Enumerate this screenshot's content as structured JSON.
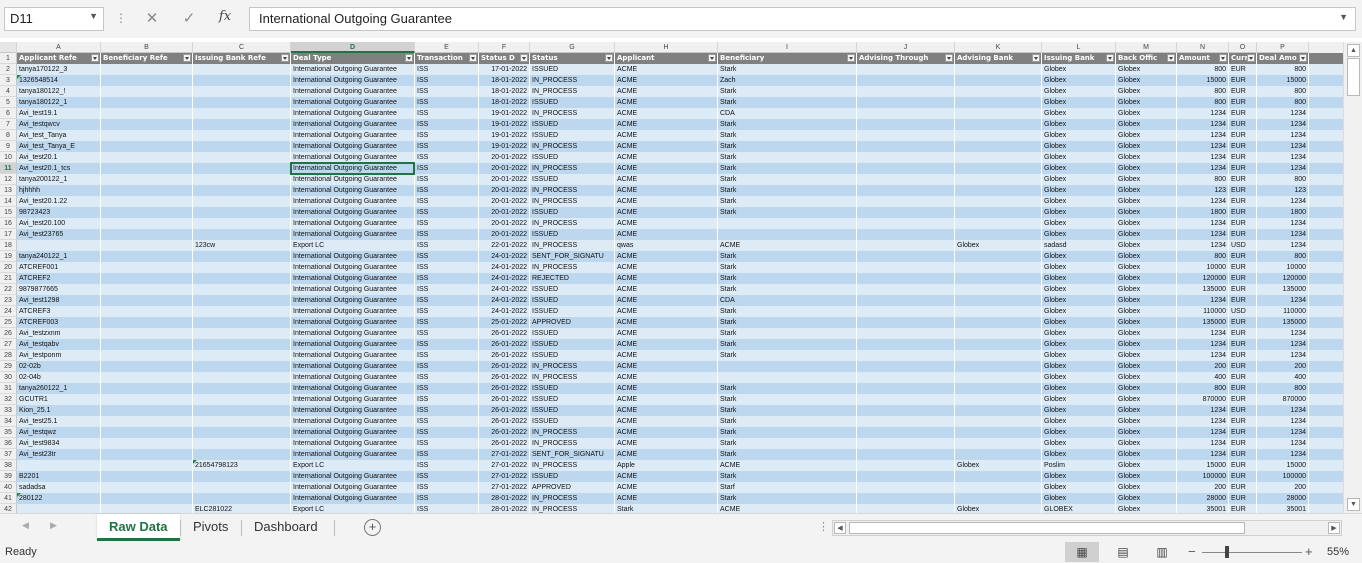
{
  "formula_bar": {
    "name_box": "D11",
    "cancel_icon": "✕",
    "enter_icon": "✓",
    "fx_label": "fx",
    "formula": "International Outgoing Guarantee"
  },
  "grid": {
    "column_letters": [
      "A",
      "B",
      "C",
      "D",
      "E",
      "F",
      "G",
      "H",
      "I",
      "J",
      "K",
      "L",
      "M",
      "N",
      "O",
      "P"
    ],
    "header_labels": [
      "Applicant Refe",
      "Beneficiary Refe",
      "Issuing Bank Refe",
      "Deal Type",
      "Transaction",
      "Status D",
      "Status",
      "Applicant",
      "Beneficiary",
      "Advising Through",
      "Advising Bank",
      "Issuing Bank",
      "Back Offic",
      "Amount",
      "Curre",
      "Deal Amo"
    ],
    "rows": [
      [
        "tanya170122_3",
        "",
        "",
        "International Outgoing Guarantee",
        "ISS",
        "17-01-2022",
        "ISSUED",
        "ACME",
        "Stark",
        "",
        "",
        "Globex",
        "Globex",
        "800",
        "EUR",
        "800"
      ],
      [
        "1326548514",
        "",
        "",
        "International Outgoing Guarantee",
        "ISS",
        "18-01-2022",
        "IN_PROCESS",
        "ACME",
        "Zach",
        "",
        "",
        "Globex",
        "Globex",
        "15000",
        "EUR",
        "15000"
      ],
      [
        "tanya180122_!",
        "",
        "",
        "International Outgoing Guarantee",
        "ISS",
        "18-01-2022",
        "IN_PROCESS",
        "ACME",
        "Stark",
        "",
        "",
        "Globex",
        "Globex",
        "800",
        "EUR",
        "800"
      ],
      [
        "tanya180122_1",
        "",
        "",
        "International Outgoing Guarantee",
        "ISS",
        "18-01-2022",
        "ISSUED",
        "ACME",
        "Stark",
        "",
        "",
        "Globex",
        "Globex",
        "800",
        "EUR",
        "800"
      ],
      [
        "Avi_test19.1",
        "",
        "",
        "International Outgoing Guarantee",
        "ISS",
        "19-01-2022",
        "IN_PROCESS",
        "ACME",
        "CDA",
        "",
        "",
        "Globex",
        "Globex",
        "1234",
        "EUR",
        "1234"
      ],
      [
        "Avi_testqwcv",
        "",
        "",
        "International Outgoing Guarantee",
        "ISS",
        "19-01-2022",
        "ISSUED",
        "ACME",
        "Stark",
        "",
        "",
        "Globex",
        "Globex",
        "1234",
        "EUR",
        "1234"
      ],
      [
        "Avi_test_Tanya",
        "",
        "",
        "International Outgoing Guarantee",
        "ISS",
        "19-01-2022",
        "ISSUED",
        "ACME",
        "Stark",
        "",
        "",
        "Globex",
        "Globex",
        "1234",
        "EUR",
        "1234"
      ],
      [
        "Avi_test_Tanya_E",
        "",
        "",
        "International Outgoing Guarantee",
        "ISS",
        "19-01-2022",
        "IN_PROCESS",
        "ACME",
        "Stark",
        "",
        "",
        "Globex",
        "Globex",
        "1234",
        "EUR",
        "1234"
      ],
      [
        "Avi_test20.1",
        "",
        "",
        "International Outgoing Guarantee",
        "ISS",
        "20-01-2022",
        "ISSUED",
        "ACME",
        "Stark",
        "",
        "",
        "Globex",
        "Globex",
        "1234",
        "EUR",
        "1234"
      ],
      [
        "Avi_test20.1_tcs",
        "",
        "",
        "International Outgoing Guarantee",
        "ISS",
        "20-01-2022",
        "IN_PROCESS",
        "ACME",
        "Stark",
        "",
        "",
        "Globex",
        "Globex",
        "1234",
        "EUR",
        "1234"
      ],
      [
        "tanya200122_1",
        "",
        "",
        "International Outgoing Guarantee",
        "ISS",
        "20-01-2022",
        "ISSUED",
        "ACME",
        "Stark",
        "",
        "",
        "Globex",
        "Globex",
        "800",
        "EUR",
        "800"
      ],
      [
        "hjhhhh",
        "",
        "",
        "International Outgoing Guarantee",
        "ISS",
        "20-01-2022",
        "IN_PROCESS",
        "ACME",
        "Stark",
        "",
        "",
        "Globex",
        "Globex",
        "123",
        "EUR",
        "123"
      ],
      [
        "Avi_test20.1.22",
        "",
        "",
        "International Outgoing Guarantee",
        "ISS",
        "20-01-2022",
        "IN_PROCESS",
        "ACME",
        "Stark",
        "",
        "",
        "Globex",
        "Globex",
        "1234",
        "EUR",
        "1234"
      ],
      [
        "98723423",
        "",
        "",
        "International Outgoing Guarantee",
        "ISS",
        "20-01-2022",
        "ISSUED",
        "ACME",
        "Stark",
        "",
        "",
        "Globex",
        "Globex",
        "1800",
        "EUR",
        "1800"
      ],
      [
        "Avi_test20.100",
        "",
        "",
        "International Outgoing Guarantee",
        "ISS",
        "20-01-2022",
        "IN_PROCESS",
        "ACME",
        "",
        "",
        "",
        "Globex",
        "Globex",
        "1234",
        "EUR",
        "1234"
      ],
      [
        "Avi_test23765",
        "",
        "",
        "International Outgoing Guarantee",
        "ISS",
        "20-01-2022",
        "ISSUED",
        "ACME",
        "",
        "",
        "",
        "Globex",
        "Globex",
        "1234",
        "EUR",
        "1234"
      ],
      [
        "",
        "",
        "123cw",
        "Export LC",
        "ISS",
        "22-01-2022",
        "IN_PROCESS",
        "qwas",
        "ACME",
        "",
        "Globex",
        "sadasd",
        "Globex",
        "1234",
        "USD",
        "1234"
      ],
      [
        "tanya240122_1",
        "",
        "",
        "International Outgoing Guarantee",
        "ISS",
        "24-01-2022",
        "SENT_FOR_SIGNATU",
        "ACME",
        "Stark",
        "",
        "",
        "Globex",
        "Globex",
        "800",
        "EUR",
        "800"
      ],
      [
        "ATCREF001",
        "",
        "",
        "International Outgoing Guarantee",
        "ISS",
        "24-01-2022",
        "IN_PROCESS",
        "ACME",
        "Stark",
        "",
        "",
        "Globex",
        "Globex",
        "10000",
        "EUR",
        "10000"
      ],
      [
        "ATCREF2",
        "",
        "",
        "International Outgoing Guarantee",
        "ISS",
        "24-01-2022",
        "REJECTED",
        "ACME",
        "Stark",
        "",
        "",
        "Globex",
        "Globex",
        "120000",
        "EUR",
        "120000"
      ],
      [
        "9879877665",
        "",
        "",
        "International Outgoing Guarantee",
        "ISS",
        "24-01-2022",
        "ISSUED",
        "ACME",
        "Stark",
        "",
        "",
        "Globex",
        "Globex",
        "135000",
        "EUR",
        "135000"
      ],
      [
        "Avi_test1298",
        "",
        "",
        "International Outgoing Guarantee",
        "ISS",
        "24-01-2022",
        "ISSUED",
        "ACME",
        "CDA",
        "",
        "",
        "Globex",
        "Globex",
        "1234",
        "EUR",
        "1234"
      ],
      [
        "ATCREF3",
        "",
        "",
        "International Outgoing Guarantee",
        "ISS",
        "24-01-2022",
        "ISSUED",
        "ACME",
        "Stark",
        "",
        "",
        "Globex",
        "Globex",
        "110000",
        "USD",
        "110000"
      ],
      [
        "ATCREF003",
        "",
        "",
        "International Outgoing Guarantee",
        "ISS",
        "25-01-2022",
        "APPROVED",
        "ACME",
        "Stark",
        "",
        "",
        "Globex",
        "Globex",
        "135000",
        "EUR",
        "135000"
      ],
      [
        "Avi_testzxnm",
        "",
        "",
        "International Outgoing Guarantee",
        "ISS",
        "26-01-2022",
        "ISSUED",
        "ACME",
        "Stark",
        "",
        "",
        "Globex",
        "Globex",
        "1234",
        "EUR",
        "1234"
      ],
      [
        "Avi_testqabv",
        "",
        "",
        "International Outgoing Guarantee",
        "ISS",
        "26-01-2022",
        "ISSUED",
        "ACME",
        "Stark",
        "",
        "",
        "Globex",
        "Globex",
        "1234",
        "EUR",
        "1234"
      ],
      [
        "Avi_testponm",
        "",
        "",
        "International Outgoing Guarantee",
        "ISS",
        "26-01-2022",
        "ISSUED",
        "ACME",
        "Stark",
        "",
        "",
        "Globex",
        "Globex",
        "1234",
        "EUR",
        "1234"
      ],
      [
        "02-02b",
        "",
        "",
        "International Outgoing Guarantee",
        "ISS",
        "26-01-2022",
        "IN_PROCESS",
        "ACME",
        "",
        "",
        "",
        "Globex",
        "Globex",
        "200",
        "EUR",
        "200"
      ],
      [
        "02-04b",
        "",
        "",
        "International Outgoing Guarantee",
        "ISS",
        "26-01-2022",
        "IN_PROCESS",
        "ACME",
        "",
        "",
        "",
        "Globex",
        "Globex",
        "400",
        "EUR",
        "400"
      ],
      [
        "tanya260122_1",
        "",
        "",
        "International Outgoing Guarantee",
        "ISS",
        "26-01-2022",
        "ISSUED",
        "ACME",
        "Stark",
        "",
        "",
        "Globex",
        "Globex",
        "800",
        "EUR",
        "800"
      ],
      [
        "GCUTR1",
        "",
        "",
        "International Outgoing Guarantee",
        "ISS",
        "26-01-2022",
        "ISSUED",
        "ACME",
        "Stark",
        "",
        "",
        "Globex",
        "Globex",
        "870000",
        "EUR",
        "870000"
      ],
      [
        "Kion_25.1",
        "",
        "",
        "International Outgoing Guarantee",
        "ISS",
        "26-01-2022",
        "ISSUED",
        "ACME",
        "Stark",
        "",
        "",
        "Globex",
        "Globex",
        "1234",
        "EUR",
        "1234"
      ],
      [
        "Avi_test25.1",
        "",
        "",
        "International Outgoing Guarantee",
        "ISS",
        "26-01-2022",
        "ISSUED",
        "ACME",
        "Stark",
        "",
        "",
        "Globex",
        "Globex",
        "1234",
        "EUR",
        "1234"
      ],
      [
        "Avi_testqwz",
        "",
        "",
        "International Outgoing Guarantee",
        "ISS",
        "26-01-2022",
        "IN_PROCESS",
        "ACME",
        "Stark",
        "",
        "",
        "Globex",
        "Globex",
        "1234",
        "EUR",
        "1234"
      ],
      [
        "Avi_test9834",
        "",
        "",
        "International Outgoing Guarantee",
        "ISS",
        "26-01-2022",
        "IN_PROCESS",
        "ACME",
        "Stark",
        "",
        "",
        "Globex",
        "Globex",
        "1234",
        "EUR",
        "1234"
      ],
      [
        "Avi_test23tr",
        "",
        "",
        "International Outgoing Guarantee",
        "ISS",
        "27-01-2022",
        "SENT_FOR_SIGNATU",
        "ACME",
        "Stark",
        "",
        "",
        "Globex",
        "Globex",
        "1234",
        "EUR",
        "1234"
      ],
      [
        "",
        "",
        "21654798123",
        "Export LC",
        "ISS",
        "27-01-2022",
        "IN_PROCESS",
        "Apple",
        "ACME",
        "",
        "Globex",
        "Poslim",
        "Globex",
        "15000",
        "EUR",
        "15000"
      ],
      [
        "B2201",
        "",
        "",
        "International Outgoing Guarantee",
        "ISS",
        "27-01-2022",
        "ISSUED",
        "ACME",
        "Stark",
        "",
        "",
        "Globex",
        "Globex",
        "100000",
        "EUR",
        "100000"
      ],
      [
        "sadadsa",
        "",
        "",
        "International Outgoing Guarantee",
        "ISS",
        "27-01-2022",
        "APPROVED",
        "ACME",
        "Starf",
        "",
        "",
        "Globex",
        "Globex",
        "200",
        "EUR",
        "200"
      ],
      [
        "280122",
        "",
        "",
        "International Outgoing Guarantee",
        "ISS",
        "28-01-2022",
        "IN_PROCESS",
        "ACME",
        "Stark",
        "",
        "",
        "Globex",
        "Globex",
        "28000",
        "EUR",
        "28000"
      ],
      [
        "",
        "",
        "ELC281022",
        "Export LC",
        "ISS",
        "28-01-2022",
        "IN_PROCESS",
        "Stark",
        "ACME",
        "",
        "Globex",
        "GLOBEX",
        "Globex",
        "35001",
        "EUR",
        "35001"
      ]
    ]
  },
  "sheet_tabs": [
    "Raw Data",
    "Pivots",
    "Dashboard"
  ],
  "active_tab": "Raw Data",
  "add_sheet_icon": "+",
  "status": {
    "ready_text": "Ready",
    "zoom_minus": "−",
    "zoom_plus": "+",
    "zoom_label": "55%",
    "zoom_level": 55
  },
  "colors": {
    "accent": "#217346",
    "band_light": "#ddebf7",
    "band_dark": "#bdd7ee",
    "header_fill": "#808080"
  }
}
